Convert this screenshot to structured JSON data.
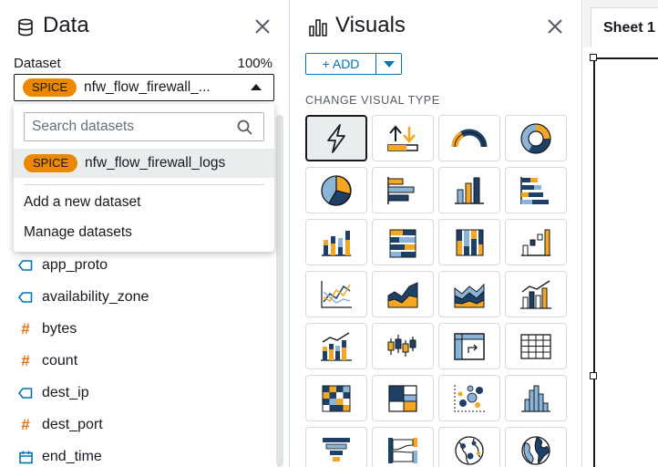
{
  "data_panel": {
    "title": "Data",
    "dataset_label": "Dataset",
    "spice_percent": "100%",
    "selected_dataset": {
      "badge": "SPICE",
      "name": "nfw_flow_firewall_..."
    },
    "dropdown": {
      "search_placeholder": "Search datasets",
      "options": [
        {
          "badge": "SPICE",
          "name": "nfw_flow_firewall_logs"
        }
      ],
      "actions": [
        "Add a new dataset",
        "Manage datasets"
      ]
    },
    "fields": [
      {
        "name": "app_proto",
        "type": "string"
      },
      {
        "name": "availability_zone",
        "type": "string"
      },
      {
        "name": "bytes",
        "type": "number"
      },
      {
        "name": "count",
        "type": "number"
      },
      {
        "name": "dest_ip",
        "type": "string"
      },
      {
        "name": "dest_port",
        "type": "number"
      },
      {
        "name": "end_time",
        "type": "date"
      }
    ]
  },
  "visuals_panel": {
    "title": "Visuals",
    "add_label": "+ ADD",
    "section_label": "CHANGE VISUAL TYPE",
    "visual_types": [
      "autograph",
      "kpi",
      "gauge",
      "donut",
      "pie",
      "horizontal-bar",
      "vertical-bar",
      "horizontal-stacked-bar",
      "vertical-stacked-bar",
      "horizontal-100-stacked-bar",
      "vertical-100-stacked-bar",
      "waterfall",
      "line",
      "area",
      "stacked-area",
      "combo-bar-line",
      "combo-stacked-bar-line",
      "box-plot",
      "pivot-table",
      "table",
      "heat-map",
      "tree-map",
      "scatter",
      "histogram",
      "funnel",
      "sankey",
      "points-on-map",
      "filled-map"
    ],
    "selected_type": "autograph"
  },
  "sheet": {
    "tab_label": "Sheet 1"
  },
  "colors": {
    "spice_orange": "#ec8800",
    "accent_blue": "#0073bb",
    "chart_navy": "#1e3f66",
    "chart_orange": "#f5a623",
    "chart_light_blue": "#8ab4d8"
  }
}
